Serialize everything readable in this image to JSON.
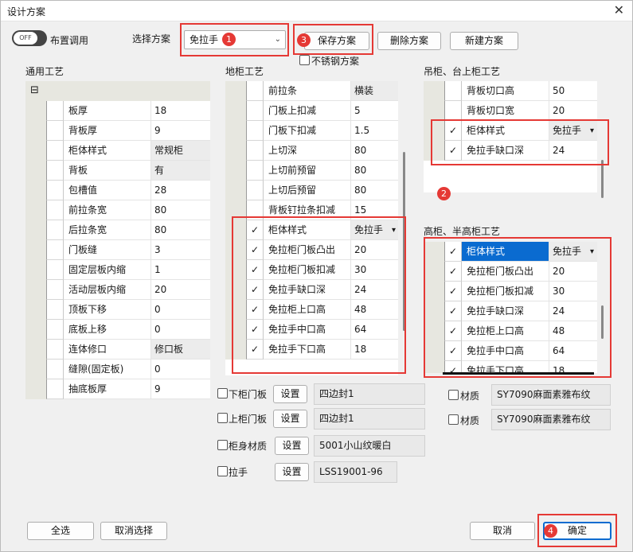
{
  "window": {
    "title": "设计方案",
    "close": "✕"
  },
  "toggle": {
    "state": "OFF",
    "label": "布置调用"
  },
  "scheme": {
    "label": "选择方案",
    "value": "免拉手",
    "save": "保存方案",
    "delete": "删除方案",
    "new": "新建方案",
    "stainless": "不锈钢方案"
  },
  "badges": [
    "1",
    "2",
    "3",
    "4"
  ],
  "general": {
    "header": "通用工艺",
    "collapse": "⊟",
    "rows": [
      {
        "label": "板厚",
        "value": "18"
      },
      {
        "label": "背板厚",
        "value": "9"
      },
      {
        "label": "柜体样式",
        "value": "常规柜"
      },
      {
        "label": "背板",
        "value": "有"
      },
      {
        "label": "包槽值",
        "value": "28"
      },
      {
        "label": "前拉条宽",
        "value": "80"
      },
      {
        "label": "后拉条宽",
        "value": "80"
      },
      {
        "label": "门板缝",
        "value": "3"
      },
      {
        "label": "固定层板内缩",
        "value": "1"
      },
      {
        "label": "活动层板内缩",
        "value": "20"
      },
      {
        "label": "顶板下移",
        "value": "0"
      },
      {
        "label": "底板上移",
        "value": "0"
      },
      {
        "label": "连体修口",
        "value": "修口板"
      },
      {
        "label": "缝隙(固定板)",
        "value": "0"
      },
      {
        "label": "抽底板厚",
        "value": "9"
      }
    ]
  },
  "floor": {
    "header": "地柜工艺",
    "rows": [
      {
        "check": "",
        "label": "前拉条",
        "value": "横装"
      },
      {
        "check": "",
        "label": "门板上扣减",
        "value": "5"
      },
      {
        "check": "",
        "label": "门板下扣减",
        "value": "1.5"
      },
      {
        "check": "",
        "label": "上切深",
        "value": "80"
      },
      {
        "check": "",
        "label": "上切前预留",
        "value": "80"
      },
      {
        "check": "",
        "label": "上切后预留",
        "value": "80"
      },
      {
        "check": "",
        "label": "背板钉拉条扣减",
        "value": "15"
      },
      {
        "check": "✓",
        "label": "柜体样式",
        "value": "免拉手",
        "dropdown": "▾"
      },
      {
        "check": "✓",
        "label": "免拉柜门板凸出",
        "value": "20"
      },
      {
        "check": "✓",
        "label": "免拉柜门板扣减",
        "value": "30"
      },
      {
        "check": "✓",
        "label": "免拉手缺口深",
        "value": "24"
      },
      {
        "check": "✓",
        "label": "免拉柜上口高",
        "value": "48"
      },
      {
        "check": "✓",
        "label": "免拉手中口高",
        "value": "64"
      },
      {
        "check": "✓",
        "label": "免拉手下口高",
        "value": "18"
      }
    ]
  },
  "hanging": {
    "header": "吊柜、台上柜工艺",
    "rows": [
      {
        "check": "",
        "label": "背板切口高",
        "value": "50"
      },
      {
        "check": "",
        "label": "背板切口宽",
        "value": "20"
      },
      {
        "check": "✓",
        "label": "柜体样式",
        "value": "免拉手",
        "dropdown": "▾"
      },
      {
        "check": "✓",
        "label": "免拉手缺口深",
        "value": "24"
      }
    ]
  },
  "tall": {
    "header": "高柜、半高柜工艺",
    "rows": [
      {
        "check": "✓",
        "label": "柜体样式",
        "value": "免拉手",
        "dropdown": "▾"
      },
      {
        "check": "✓",
        "label": "免拉柜门板凸出",
        "value": "20"
      },
      {
        "check": "✓",
        "label": "免拉柜门板扣减",
        "value": "30"
      },
      {
        "check": "✓",
        "label": "免拉手缺口深",
        "value": "24"
      },
      {
        "check": "✓",
        "label": "免拉柜上口高",
        "value": "48"
      },
      {
        "check": "✓",
        "label": "免拉手中口高",
        "value": "64"
      },
      {
        "check": "✓",
        "label": "免拉手下口高",
        "value": "18"
      }
    ]
  },
  "materials": [
    {
      "label": "下柜门板",
      "btn": "设置",
      "value": "四边封1"
    },
    {
      "label": "上柜门板",
      "btn": "设置",
      "value": "四边封1"
    },
    {
      "label": "柜身材质",
      "btn": "设置",
      "value": "5001小山纹暖白"
    },
    {
      "label": "拉手",
      "btn": "设置",
      "value": "LSS19001-96"
    }
  ],
  "materials_right": [
    {
      "label": "材质",
      "value": "SY7090麻面素雅布纹"
    },
    {
      "label": "材质",
      "value": "SY7090麻面素雅布纹"
    }
  ],
  "footer": {
    "select_all": "全选",
    "deselect": "取消选择",
    "cancel": "取消",
    "ok": "确定"
  }
}
